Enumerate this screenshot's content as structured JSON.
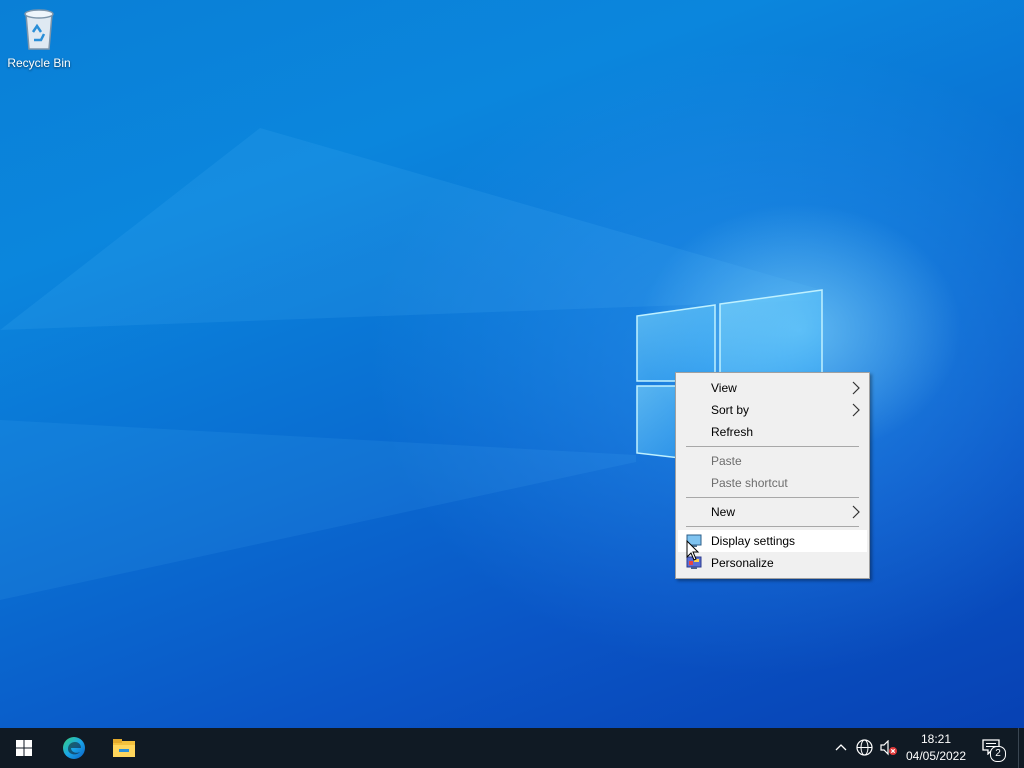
{
  "desktop": {
    "icons": [
      {
        "label": "Recycle Bin",
        "icon": "recycle-bin-icon"
      }
    ]
  },
  "context_menu": {
    "items": [
      {
        "label": "View",
        "has_submenu": true,
        "enabled": true
      },
      {
        "label": "Sort by",
        "has_submenu": true,
        "enabled": true
      },
      {
        "label": "Refresh",
        "has_submenu": false,
        "enabled": true
      },
      {
        "label": "Paste",
        "has_submenu": false,
        "enabled": false
      },
      {
        "label": "Paste shortcut",
        "has_submenu": false,
        "enabled": false
      },
      {
        "label": "New",
        "has_submenu": true,
        "enabled": true
      },
      {
        "label": "Display settings",
        "icon": "display-settings-icon",
        "enabled": true,
        "highlighted": true
      },
      {
        "label": "Personalize",
        "icon": "personalize-icon",
        "enabled": true
      }
    ]
  },
  "taskbar": {
    "start_icon": "windows-logo-icon",
    "pinned": [
      "edge-icon",
      "file-explorer-icon"
    ],
    "tray_icons": [
      "chevron-up-icon",
      "network-globe-icon",
      "volume-muted-icon"
    ],
    "clock": {
      "time": "18:21",
      "date": "04/05/2022"
    },
    "notifications": {
      "icon": "action-center-icon",
      "count": "2"
    }
  },
  "colors": {
    "taskbar": "#101a24",
    "menu_bg": "#f0f0f0",
    "desktop_accent": "#0a7fd6"
  }
}
